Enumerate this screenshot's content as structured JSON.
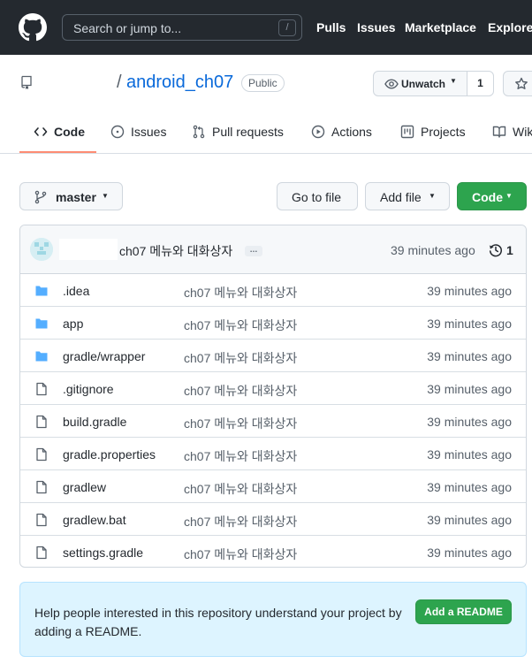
{
  "header": {
    "search_placeholder": "Search or jump to...",
    "search_shortcut": "/",
    "nav": [
      "Pulls",
      "Issues",
      "Marketplace",
      "Explore"
    ]
  },
  "repo": {
    "separator": "/",
    "name": "android_ch07",
    "visibility": "Public",
    "unwatch_label": "Unwatch",
    "watch_count": "1"
  },
  "tabs": [
    {
      "label": "Code",
      "icon": "code-icon"
    },
    {
      "label": "Issues",
      "icon": "issue-opened-icon"
    },
    {
      "label": "Pull requests",
      "icon": "git-pull-request-icon"
    },
    {
      "label": "Actions",
      "icon": "play-icon"
    },
    {
      "label": "Projects",
      "icon": "project-icon"
    },
    {
      "label": "Wiki",
      "icon": "book-icon"
    }
  ],
  "toolbar": {
    "branch": "master",
    "go_to_file": "Go to file",
    "add_file": "Add file",
    "code": "Code"
  },
  "commit": {
    "message": "ch07 메뉴와 대화상자",
    "ellipsis": "…",
    "time": "39 minutes ago",
    "history_count": "1"
  },
  "files": [
    {
      "name": ".idea",
      "type": "dir",
      "message": "ch07 메뉴와 대화상자",
      "time": "39 minutes ago"
    },
    {
      "name": "app",
      "type": "dir",
      "message": "ch07 메뉴와 대화상자",
      "time": "39 minutes ago"
    },
    {
      "name": "gradle/wrapper",
      "type": "dir",
      "message": "ch07 메뉴와 대화상자",
      "time": "39 minutes ago"
    },
    {
      "name": ".gitignore",
      "type": "file",
      "message": "ch07 메뉴와 대화상자",
      "time": "39 minutes ago"
    },
    {
      "name": "build.gradle",
      "type": "file",
      "message": "ch07 메뉴와 대화상자",
      "time": "39 minutes ago"
    },
    {
      "name": "gradle.properties",
      "type": "file",
      "message": "ch07 메뉴와 대화상자",
      "time": "39 minutes ago"
    },
    {
      "name": "gradlew",
      "type": "file",
      "message": "ch07 메뉴와 대화상자",
      "time": "39 minutes ago"
    },
    {
      "name": "gradlew.bat",
      "type": "file",
      "message": "ch07 메뉴와 대화상자",
      "time": "39 minutes ago"
    },
    {
      "name": "settings.gradle",
      "type": "file",
      "message": "ch07 메뉴와 대화상자",
      "time": "39 minutes ago"
    }
  ],
  "readme_prompt": {
    "text": "Help people interested in this repository understand your project by adding a README.",
    "button": "Add a README"
  },
  "colors": {
    "header_bg": "#24292f",
    "link": "#0969da",
    "green": "#2da44e",
    "tab_underline": "#fd8c73",
    "folder": "#54aeff",
    "readme_bg": "#ddf4ff"
  }
}
